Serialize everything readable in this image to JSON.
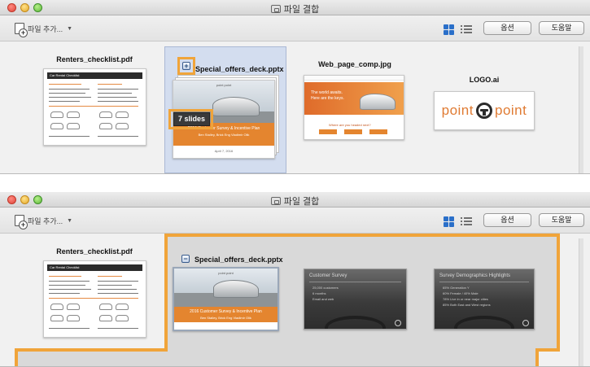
{
  "window_top": {
    "title": "파일 결합",
    "toolbar": {
      "add_files_label": "파일 추가...",
      "options_label": "옵션",
      "help_label": "도움말"
    },
    "files": [
      {
        "name": "Renters_checklist.pdf"
      },
      {
        "name": "Special_offers_deck.pptx",
        "slides_badge": "7 slides"
      },
      {
        "name": "Web_page_comp.jpg"
      },
      {
        "name": "LOGO.ai"
      }
    ]
  },
  "window_bottom": {
    "title": "파일 결합",
    "toolbar": {
      "add_files_label": "파일 추가...",
      "options_label": "옵션",
      "help_label": "도움말"
    },
    "files": [
      {
        "name": "Renters_checklist.pdf"
      },
      {
        "name": "Special_offers_deck.pptx"
      }
    ],
    "slides": [
      {
        "title": "Customer Survey",
        "bullets": [
          "25,000 customers",
          "6 months",
          "Email and web"
        ]
      },
      {
        "title": "Survey Demographics Highlights",
        "bullets": [
          "65% Generation Y",
          "60% Female / 40% Male",
          "78% Live in or near major cities",
          "85% Both East and West regions"
        ]
      }
    ]
  },
  "thumb_text": {
    "checklist_header": "Car Rental Checklist",
    "brand": "point point",
    "deck_band_title": "2016 Customer Survey & Incentive Plan",
    "deck_band_subtitle": "Ben Stalley, Brick Eng Vladimir Olik",
    "deck_date": "April 7, 2016",
    "web_hero_line1": "The world awaits.",
    "web_hero_line2": "Here are the keys.",
    "web_sub": "Where are you headed next?",
    "logo_left": "point",
    "logo_right": "point"
  },
  "colors": {
    "accent_orange": "#f0a43a",
    "selection_blue": "#d3ddef",
    "view_active": "#2a6fc9",
    "brand_orange": "#e07b33"
  },
  "icons": [
    "file-combine-icon",
    "add-files-icon",
    "grid-view-icon",
    "list-view-icon",
    "expand-plus-icon",
    "collapse-minus-icon"
  ]
}
